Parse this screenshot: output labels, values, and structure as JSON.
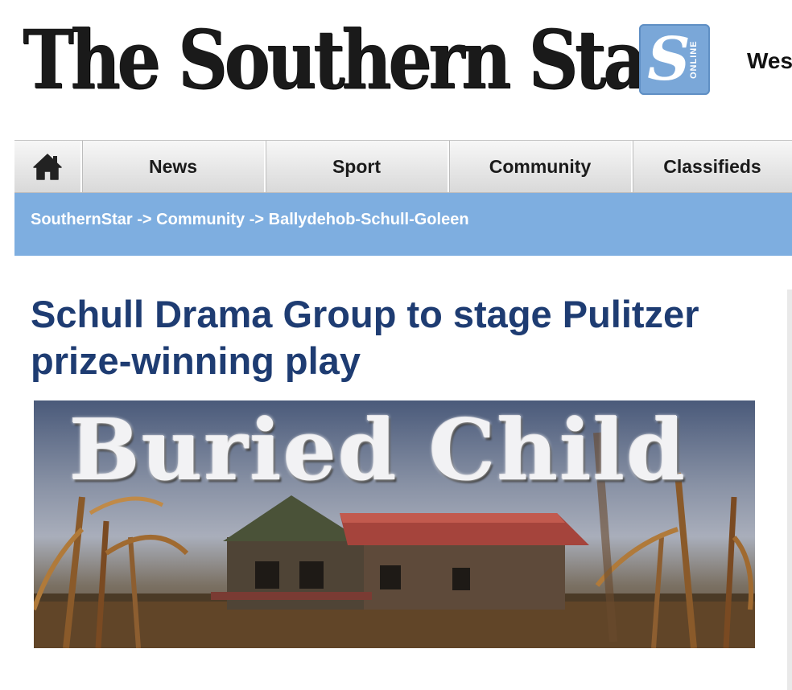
{
  "masthead": {
    "logo_text": "The Southern Star",
    "badge_letter": "S",
    "badge_caption": "ONLINE",
    "region_text": "Wes",
    "badge_color": "#7aa7d8"
  },
  "nav": {
    "home_icon": "home-icon",
    "items": [
      {
        "label": "News"
      },
      {
        "label": "Sport"
      },
      {
        "label": "Community"
      },
      {
        "label": "Classifieds"
      }
    ]
  },
  "breadcrumb": {
    "items": [
      "SouthernStar",
      "Community",
      "Ballydehob-Schull-Goleen"
    ],
    "separator": "->",
    "background": "#7eaee0"
  },
  "article": {
    "title": "Schull Drama Group to stage Pulitzer prize-winning play",
    "title_color": "#1e3c72",
    "image_text": "Buried Child"
  }
}
